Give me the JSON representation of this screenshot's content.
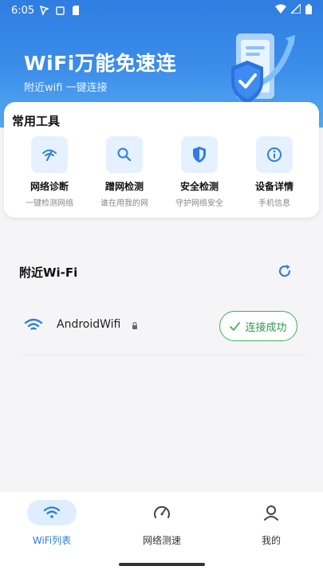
{
  "status_bar": {
    "time": "6:05"
  },
  "header": {
    "title": "WiFi万能免速连",
    "subtitle": "附近wifi 一键连接"
  },
  "tools": {
    "title": "常用工具",
    "items": [
      {
        "label": "网络诊断",
        "desc": "一键检测网络",
        "icon": "network-diagnosis-icon"
      },
      {
        "label": "蹭网检测",
        "desc": "谁在用我的网",
        "icon": "search-icon"
      },
      {
        "label": "安全检测",
        "desc": "守护网络安全",
        "icon": "shield-icon"
      },
      {
        "label": "设备详情",
        "desc": "手机信息",
        "icon": "info-icon"
      }
    ]
  },
  "nearby": {
    "title": "附近Wi-Fi",
    "networks": [
      {
        "ssid": "AndroidWifi",
        "locked": true,
        "action": "连接成功"
      }
    ]
  },
  "nav": {
    "items": [
      {
        "label": "WiFi列表",
        "icon": "wifi-icon",
        "active": true
      },
      {
        "label": "网络测速",
        "icon": "speedometer-icon",
        "active": false
      },
      {
        "label": "我的",
        "icon": "user-icon",
        "active": false
      }
    ]
  },
  "colors": {
    "accent": "#2f7de1",
    "success": "#3db05a",
    "icon_bg": "#e6f1ff"
  }
}
